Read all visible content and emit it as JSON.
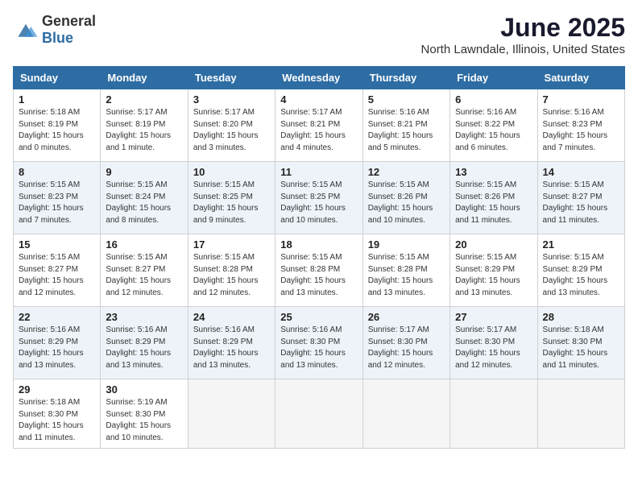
{
  "logo": {
    "general": "General",
    "blue": "Blue"
  },
  "header": {
    "title": "June 2025",
    "subtitle": "North Lawndale, Illinois, United States"
  },
  "days_of_week": [
    "Sunday",
    "Monday",
    "Tuesday",
    "Wednesday",
    "Thursday",
    "Friday",
    "Saturday"
  ],
  "weeks": [
    [
      {
        "day": "1",
        "sunrise": "Sunrise: 5:18 AM",
        "sunset": "Sunset: 8:19 PM",
        "daylight": "Daylight: 15 hours and 0 minutes."
      },
      {
        "day": "2",
        "sunrise": "Sunrise: 5:17 AM",
        "sunset": "Sunset: 8:19 PM",
        "daylight": "Daylight: 15 hours and 1 minute."
      },
      {
        "day": "3",
        "sunrise": "Sunrise: 5:17 AM",
        "sunset": "Sunset: 8:20 PM",
        "daylight": "Daylight: 15 hours and 3 minutes."
      },
      {
        "day": "4",
        "sunrise": "Sunrise: 5:17 AM",
        "sunset": "Sunset: 8:21 PM",
        "daylight": "Daylight: 15 hours and 4 minutes."
      },
      {
        "day": "5",
        "sunrise": "Sunrise: 5:16 AM",
        "sunset": "Sunset: 8:21 PM",
        "daylight": "Daylight: 15 hours and 5 minutes."
      },
      {
        "day": "6",
        "sunrise": "Sunrise: 5:16 AM",
        "sunset": "Sunset: 8:22 PM",
        "daylight": "Daylight: 15 hours and 6 minutes."
      },
      {
        "day": "7",
        "sunrise": "Sunrise: 5:16 AM",
        "sunset": "Sunset: 8:23 PM",
        "daylight": "Daylight: 15 hours and 7 minutes."
      }
    ],
    [
      {
        "day": "8",
        "sunrise": "Sunrise: 5:15 AM",
        "sunset": "Sunset: 8:23 PM",
        "daylight": "Daylight: 15 hours and 7 minutes."
      },
      {
        "day": "9",
        "sunrise": "Sunrise: 5:15 AM",
        "sunset": "Sunset: 8:24 PM",
        "daylight": "Daylight: 15 hours and 8 minutes."
      },
      {
        "day": "10",
        "sunrise": "Sunrise: 5:15 AM",
        "sunset": "Sunset: 8:25 PM",
        "daylight": "Daylight: 15 hours and 9 minutes."
      },
      {
        "day": "11",
        "sunrise": "Sunrise: 5:15 AM",
        "sunset": "Sunset: 8:25 PM",
        "daylight": "Daylight: 15 hours and 10 minutes."
      },
      {
        "day": "12",
        "sunrise": "Sunrise: 5:15 AM",
        "sunset": "Sunset: 8:26 PM",
        "daylight": "Daylight: 15 hours and 10 minutes."
      },
      {
        "day": "13",
        "sunrise": "Sunrise: 5:15 AM",
        "sunset": "Sunset: 8:26 PM",
        "daylight": "Daylight: 15 hours and 11 minutes."
      },
      {
        "day": "14",
        "sunrise": "Sunrise: 5:15 AM",
        "sunset": "Sunset: 8:27 PM",
        "daylight": "Daylight: 15 hours and 11 minutes."
      }
    ],
    [
      {
        "day": "15",
        "sunrise": "Sunrise: 5:15 AM",
        "sunset": "Sunset: 8:27 PM",
        "daylight": "Daylight: 15 hours and 12 minutes."
      },
      {
        "day": "16",
        "sunrise": "Sunrise: 5:15 AM",
        "sunset": "Sunset: 8:27 PM",
        "daylight": "Daylight: 15 hours and 12 minutes."
      },
      {
        "day": "17",
        "sunrise": "Sunrise: 5:15 AM",
        "sunset": "Sunset: 8:28 PM",
        "daylight": "Daylight: 15 hours and 12 minutes."
      },
      {
        "day": "18",
        "sunrise": "Sunrise: 5:15 AM",
        "sunset": "Sunset: 8:28 PM",
        "daylight": "Daylight: 15 hours and 13 minutes."
      },
      {
        "day": "19",
        "sunrise": "Sunrise: 5:15 AM",
        "sunset": "Sunset: 8:28 PM",
        "daylight": "Daylight: 15 hours and 13 minutes."
      },
      {
        "day": "20",
        "sunrise": "Sunrise: 5:15 AM",
        "sunset": "Sunset: 8:29 PM",
        "daylight": "Daylight: 15 hours and 13 minutes."
      },
      {
        "day": "21",
        "sunrise": "Sunrise: 5:15 AM",
        "sunset": "Sunset: 8:29 PM",
        "daylight": "Daylight: 15 hours and 13 minutes."
      }
    ],
    [
      {
        "day": "22",
        "sunrise": "Sunrise: 5:16 AM",
        "sunset": "Sunset: 8:29 PM",
        "daylight": "Daylight: 15 hours and 13 minutes."
      },
      {
        "day": "23",
        "sunrise": "Sunrise: 5:16 AM",
        "sunset": "Sunset: 8:29 PM",
        "daylight": "Daylight: 15 hours and 13 minutes."
      },
      {
        "day": "24",
        "sunrise": "Sunrise: 5:16 AM",
        "sunset": "Sunset: 8:29 PM",
        "daylight": "Daylight: 15 hours and 13 minutes."
      },
      {
        "day": "25",
        "sunrise": "Sunrise: 5:16 AM",
        "sunset": "Sunset: 8:30 PM",
        "daylight": "Daylight: 15 hours and 13 minutes."
      },
      {
        "day": "26",
        "sunrise": "Sunrise: 5:17 AM",
        "sunset": "Sunset: 8:30 PM",
        "daylight": "Daylight: 15 hours and 12 minutes."
      },
      {
        "day": "27",
        "sunrise": "Sunrise: 5:17 AM",
        "sunset": "Sunset: 8:30 PM",
        "daylight": "Daylight: 15 hours and 12 minutes."
      },
      {
        "day": "28",
        "sunrise": "Sunrise: 5:18 AM",
        "sunset": "Sunset: 8:30 PM",
        "daylight": "Daylight: 15 hours and 11 minutes."
      }
    ],
    [
      {
        "day": "29",
        "sunrise": "Sunrise: 5:18 AM",
        "sunset": "Sunset: 8:30 PM",
        "daylight": "Daylight: 15 hours and 11 minutes."
      },
      {
        "day": "30",
        "sunrise": "Sunrise: 5:19 AM",
        "sunset": "Sunset: 8:30 PM",
        "daylight": "Daylight: 15 hours and 10 minutes."
      },
      null,
      null,
      null,
      null,
      null
    ]
  ]
}
